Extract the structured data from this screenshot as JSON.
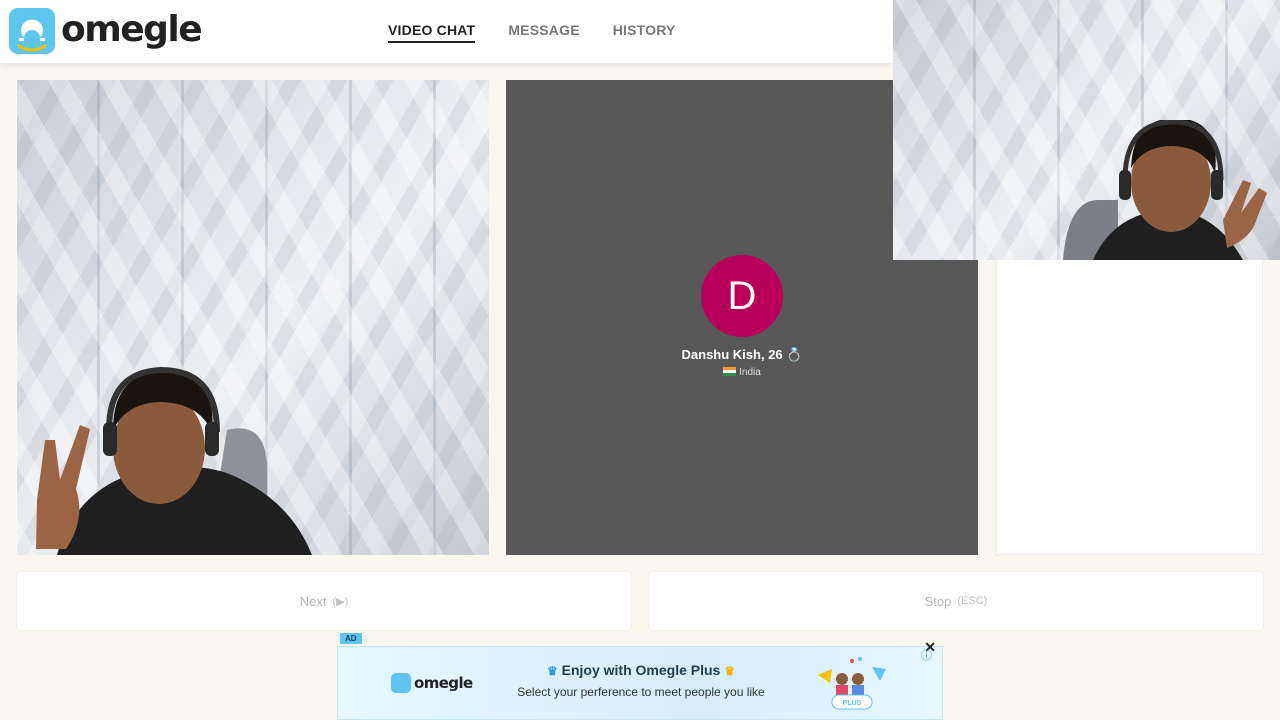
{
  "brand": {
    "name": "omegle",
    "accent": "#5ec4f0",
    "logo_yellow": "#f5c400"
  },
  "nav": {
    "items": [
      {
        "label": "VIDEO CHAT",
        "active": true
      },
      {
        "label": "MESSAGE",
        "active": false
      },
      {
        "label": "HISTORY",
        "active": false
      }
    ]
  },
  "stranger": {
    "initial": "D",
    "name": "Danshu Kish, 26",
    "relationship_icon": "💍",
    "country": "India",
    "avatar_color": "#b8005a"
  },
  "controls": {
    "next_label": "Next",
    "next_hint": "(▶)",
    "stop_label": "Stop",
    "stop_hint": "(ESC)"
  },
  "ad": {
    "tag": "AD",
    "logo_text": "omegle",
    "headline": "Enjoy with Omegle Plus",
    "subtext": "Select your perference to meet people you like",
    "badge": "PLUS",
    "close_icon": "✕",
    "info_icon": "ⓘ"
  }
}
